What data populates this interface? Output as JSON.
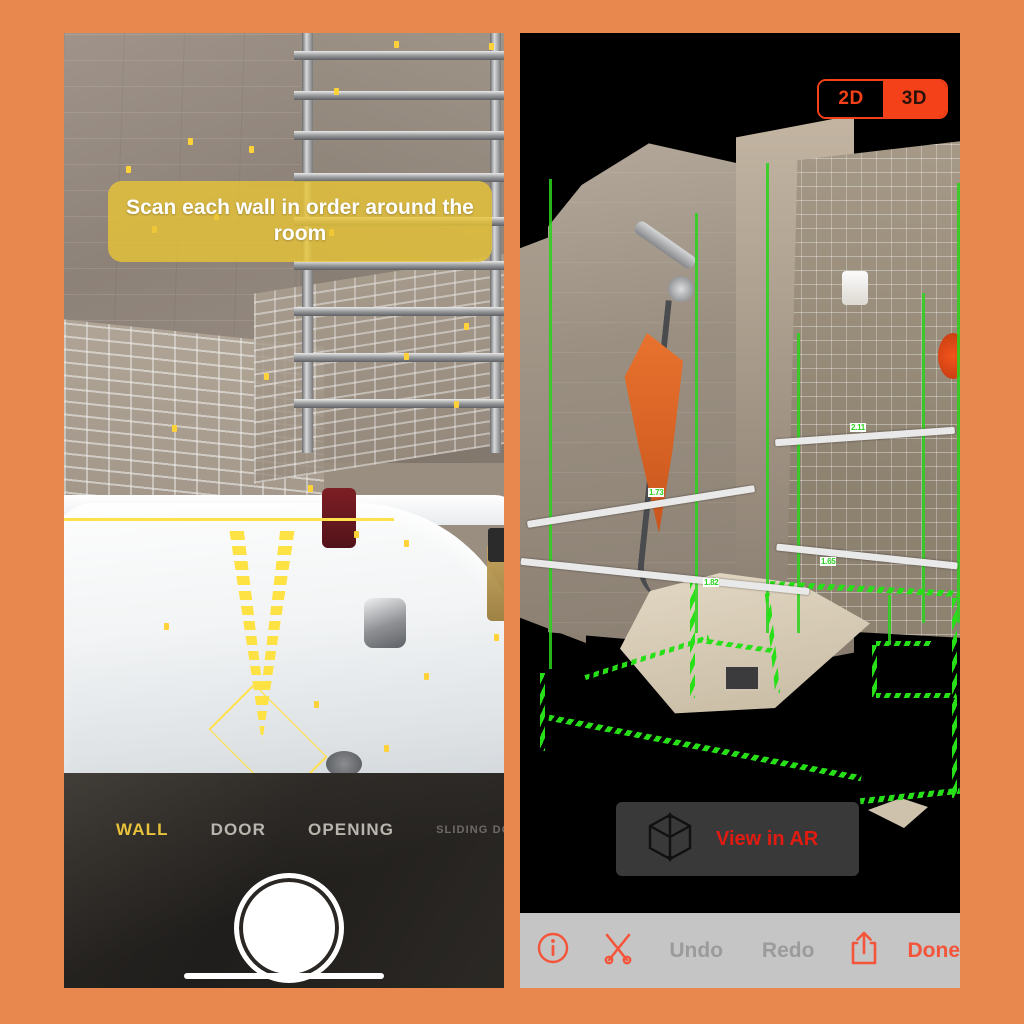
{
  "background_color": "#E8884E",
  "left_panel": {
    "name": "ar-scan-camera-view",
    "instruction_banner": {
      "text": "Scan each wall in order around the room",
      "background_color": "#E8C436",
      "text_color": "#FFFFFF"
    },
    "mode_selector": {
      "items": [
        {
          "label": "WALL",
          "active": true
        },
        {
          "label": "DOOR",
          "active": false
        },
        {
          "label": "OPENING",
          "active": false
        },
        {
          "label": "SLIDING DOOR",
          "active": false,
          "truncated": true
        }
      ],
      "active_color": "#E8C23A",
      "inactive_color": "#B9B5AE"
    },
    "shutter_button_label": "capture",
    "overlay": {
      "guide_color": "#FFE14D",
      "feature_point_color": "#FFD23A"
    }
  },
  "right_panel": {
    "name": "room-model-view",
    "view_toggle": {
      "options": [
        {
          "label": "2D",
          "active": false
        },
        {
          "label": "3D",
          "active": true
        }
      ],
      "accent_color": "#F4411A"
    },
    "ar_button": {
      "label": "View in AR",
      "icon": "ar-cube-icon",
      "text_color": "#E01B12"
    },
    "model": {
      "outline_color": "#28E018",
      "dimension_line_color": "#E9E9E9",
      "dimension_labels": [
        "1.73",
        "1.82",
        "2.11",
        "1.65"
      ]
    },
    "toolbar": {
      "background_color": "#C5C5C5",
      "items": [
        {
          "label": "",
          "icon": "info-icon",
          "state": "enabled"
        },
        {
          "label": "",
          "icon": "scissors-icon",
          "state": "enabled"
        },
        {
          "label": "Undo",
          "icon": "",
          "state": "disabled"
        },
        {
          "label": "Redo",
          "icon": "",
          "state": "disabled"
        },
        {
          "label": "",
          "icon": "share-icon",
          "state": "enabled"
        },
        {
          "label": "Done",
          "icon": "",
          "state": "enabled"
        }
      ],
      "accent_color": "#F4553A",
      "disabled_color": "#9B9B9B"
    }
  }
}
